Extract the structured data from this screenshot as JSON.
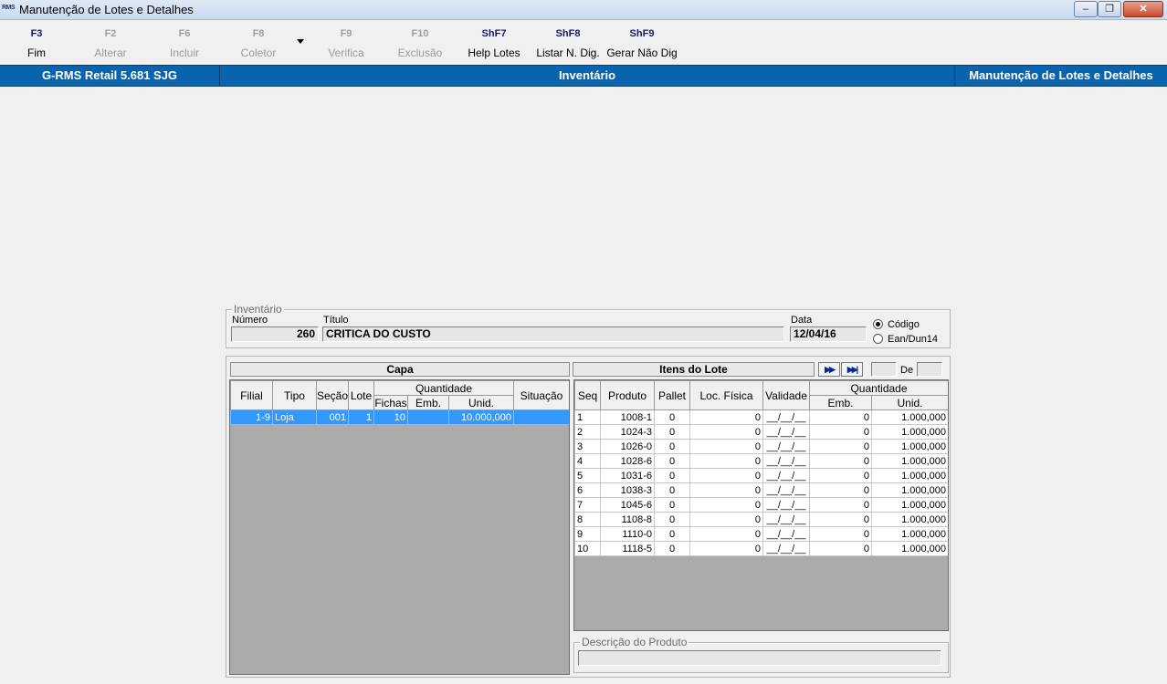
{
  "window": {
    "title": "Manutenção de Lotes e Detalhes",
    "icon_text": "RMS",
    "minimize": "–",
    "maximize": "❐",
    "close": "✕"
  },
  "toolbar": [
    {
      "key": "F3",
      "label": "Fim",
      "enabled": true
    },
    {
      "key": "F2",
      "label": "Alterar",
      "enabled": false
    },
    {
      "key": "F6",
      "label": "Incluir",
      "enabled": false
    },
    {
      "key": "F8",
      "label": "Coletor",
      "enabled": false
    },
    {
      "key": "F9",
      "label": "Verifica",
      "enabled": false
    },
    {
      "key": "F10",
      "label": "Exclusão",
      "enabled": false
    },
    {
      "key": "ShF7",
      "label": "Help Lotes",
      "enabled": true
    },
    {
      "key": "ShF8",
      "label": "Listar N. Dig.",
      "enabled": true
    },
    {
      "key": "ShF9",
      "label": "Gerar Não Dig",
      "enabled": true
    }
  ],
  "header": {
    "left": "G-RMS Retail 5.681 SJG",
    "center": "Inventário",
    "right": "Manutenção de Lotes e Detalhes"
  },
  "inventario": {
    "legend": "Inventário",
    "numero_label": "Número",
    "numero": "260",
    "titulo_label": "Título",
    "titulo": "CRITICA DO CUSTO",
    "data_label": "Data",
    "data": "12/04/16",
    "radio_codigo": "Código",
    "radio_ean": "Ean/Dun14",
    "selected": "codigo"
  },
  "capa": {
    "title": "Capa",
    "headers": {
      "filial": "Filial",
      "tipo": "Tipo",
      "secao": "Seção",
      "lote": "Lote",
      "quantidade": "Quantidade",
      "fichas": "Fichas",
      "emb": "Emb.",
      "unid": "Unid.",
      "situacao": "Situação"
    },
    "rows": [
      {
        "filial": "1-9",
        "tipo": "Loja",
        "secao": "001",
        "lote": "1",
        "fichas": "10",
        "emb": "",
        "unid": "10.000,000",
        "situacao": ""
      }
    ]
  },
  "itens": {
    "title": "Itens do Lote",
    "nav_next": "▶▶",
    "nav_last": "▶▶|",
    "de_label": "De",
    "headers": {
      "seq": "Seq",
      "produto": "Produto",
      "pallet": "Pallet",
      "loc": "Loc. Física",
      "validade": "Validade",
      "quantidade": "Quantidade",
      "emb": "Emb.",
      "unid": "Unid."
    },
    "rows": [
      {
        "seq": "1",
        "produto": "1008-1",
        "pallet": "0",
        "loc": "0",
        "validade": "__/__/__",
        "emb": "0",
        "unid": "1.000,000"
      },
      {
        "seq": "2",
        "produto": "1024-3",
        "pallet": "0",
        "loc": "0",
        "validade": "__/__/__",
        "emb": "0",
        "unid": "1.000,000"
      },
      {
        "seq": "3",
        "produto": "1026-0",
        "pallet": "0",
        "loc": "0",
        "validade": "__/__/__",
        "emb": "0",
        "unid": "1.000,000"
      },
      {
        "seq": "4",
        "produto": "1028-6",
        "pallet": "0",
        "loc": "0",
        "validade": "__/__/__",
        "emb": "0",
        "unid": "1.000,000"
      },
      {
        "seq": "5",
        "produto": "1031-6",
        "pallet": "0",
        "loc": "0",
        "validade": "__/__/__",
        "emb": "0",
        "unid": "1.000,000"
      },
      {
        "seq": "6",
        "produto": "1038-3",
        "pallet": "0",
        "loc": "0",
        "validade": "__/__/__",
        "emb": "0",
        "unid": "1.000,000"
      },
      {
        "seq": "7",
        "produto": "1045-6",
        "pallet": "0",
        "loc": "0",
        "validade": "__/__/__",
        "emb": "0",
        "unid": "1.000,000"
      },
      {
        "seq": "8",
        "produto": "1108-8",
        "pallet": "0",
        "loc": "0",
        "validade": "__/__/__",
        "emb": "0",
        "unid": "1.000,000"
      },
      {
        "seq": "9",
        "produto": "1110-0",
        "pallet": "0",
        "loc": "0",
        "validade": "__/__/__",
        "emb": "0",
        "unid": "1.000,000"
      },
      {
        "seq": "10",
        "produto": "1118-5",
        "pallet": "0",
        "loc": "0",
        "validade": "__/__/__",
        "emb": "0",
        "unid": "1.000,000"
      }
    ]
  },
  "descricao": {
    "legend": "Descrição do Produto",
    "value": ""
  }
}
